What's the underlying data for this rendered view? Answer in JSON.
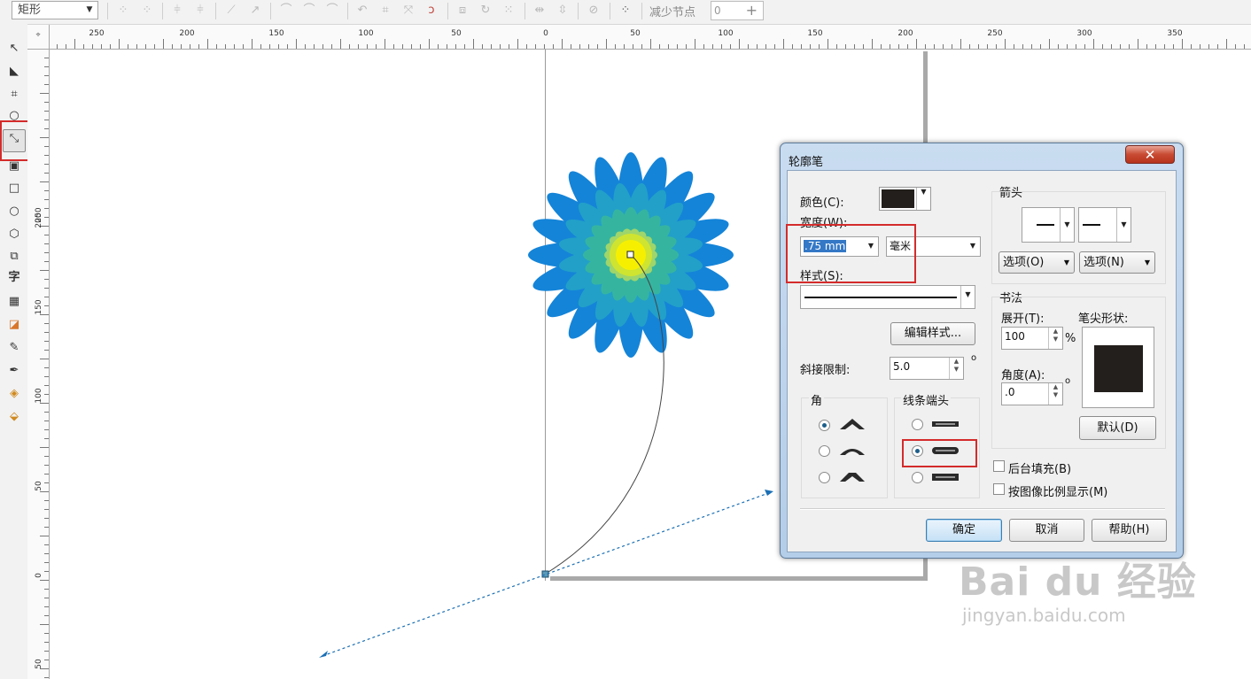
{
  "property_bar": {
    "shape_combo": "矩形",
    "reduce_nodes_label": "减少节点",
    "reduce_nodes_value": "0"
  },
  "rulers": {
    "top_labels": [
      "250",
      "200",
      "150",
      "100",
      "50",
      "0",
      "50",
      "100",
      "150",
      "200",
      "250",
      "300",
      "350"
    ],
    "left_labels": [
      "250",
      "200",
      "150",
      "100",
      "50",
      "0",
      "50"
    ]
  },
  "dialog": {
    "title": "轮廓笔",
    "close_glyph": "✕",
    "color_label": "颜色(C):",
    "color_value": "#231f1c",
    "width_label": "宽度(W):",
    "width_value": ".75 mm",
    "unit_value": "毫米",
    "style_label": "样式(S):",
    "edit_style_button": "编辑样式...",
    "miter_label": "斜接限制:",
    "miter_value": "5.0",
    "degree_symbol": "o",
    "corner_label": "角",
    "line_cap_label": "线条端头",
    "arrow_label": "箭头",
    "arrow_options_left": "选项(O)",
    "arrow_options_right": "选项(N)",
    "calligraphy_label": "书法",
    "stretch_label": "展开(T):",
    "stretch_value": "100",
    "percent": "%",
    "angle_label": "角度(A):",
    "angle_value": ".0",
    "nib_shape_label": "笔尖形状:",
    "default_button": "默认(D)",
    "behind_fill_label": "后台填充(B)",
    "scale_with_image_label": "按图像比例显示(M)",
    "ok_button": "确定",
    "cancel_button": "取消",
    "help_button": "帮助(H)",
    "selected_cap": 1,
    "selected_corner": 0
  },
  "watermark": {
    "brand": "Bai du 经验",
    "url": "jingyan.baidu.com"
  },
  "colors": {
    "highlight_red": "#d42b2b",
    "petal_blue": "#1484d8",
    "petal_green": "#35b5a0",
    "center_yellow": "#f5f000",
    "selection_blue": "#1a6fb5"
  }
}
